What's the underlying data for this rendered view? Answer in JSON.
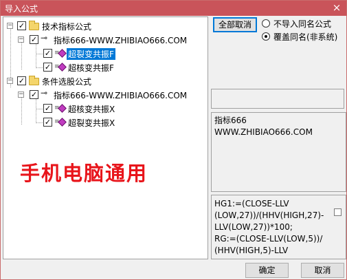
{
  "window": {
    "title": "导入公式",
    "close_label": "×"
  },
  "tree": {
    "nodes": [
      {
        "label": "技术指标公式",
        "checked": "✓",
        "expander": "−"
      },
      {
        "label": "指标666-WWW.ZHIBIAO666.COM",
        "checked": "✓",
        "expander": "−"
      },
      {
        "label": "超裂变共振F",
        "checked": "✓",
        "selected": true
      },
      {
        "label": "超核变共振F",
        "checked": "✓"
      },
      {
        "label": "条件选股公式",
        "checked": "✓",
        "expander": "−"
      },
      {
        "label": "指标666-WWW.ZHIBIAO666.COM",
        "checked": "✓",
        "expander": "−"
      },
      {
        "label": "超核变共振X",
        "checked": "✓"
      },
      {
        "label": "超裂变共振X",
        "checked": "✓"
      }
    ]
  },
  "watermark": "手机电脑通用",
  "buttons": {
    "cancel_all": "全部取消",
    "ok": "确定",
    "cancel": "取消"
  },
  "options": {
    "no_import_same_name": "不导入同名公式",
    "overwrite_same_name": "覆盖同名(非系统)"
  },
  "info": {
    "line1": "指标666",
    "line2": "WWW.ZHIBIAO666.COM"
  },
  "formula_text": "HG1:=(CLOSE-LLV\n(LOW,27))/(HHV(HIGH,27)-\nLLV(LOW,27))*100;\nRG:=(CLOSE-LLV(LOW,5))/\n(HHV(HIGH,5)-LLV",
  "colors": {
    "titlebar": "#c9545a",
    "selection": "#0078d7",
    "watermark": "#e8151b"
  }
}
